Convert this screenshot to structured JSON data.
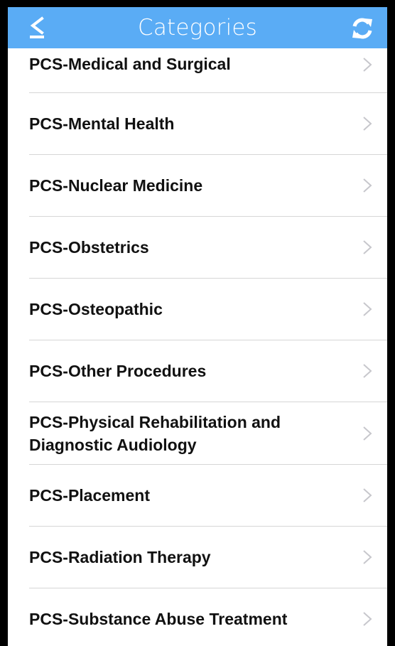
{
  "header": {
    "title": "Categories",
    "background_color": "#5aacf5",
    "back_icon": "back-arrow-icon",
    "refresh_icon": "refresh-icon"
  },
  "categories": [
    {
      "label": "PCS-Medical and Surgical"
    },
    {
      "label": "PCS-Mental Health"
    },
    {
      "label": "PCS-Nuclear Medicine"
    },
    {
      "label": "PCS-Obstetrics"
    },
    {
      "label": "PCS-Osteopathic"
    },
    {
      "label": "PCS-Other Procedures"
    },
    {
      "label": "PCS-Physical Rehabilitation and Diagnostic Audiology"
    },
    {
      "label": "PCS-Placement"
    },
    {
      "label": "PCS-Radiation Therapy"
    },
    {
      "label": "PCS-Substance Abuse Treatment"
    }
  ]
}
